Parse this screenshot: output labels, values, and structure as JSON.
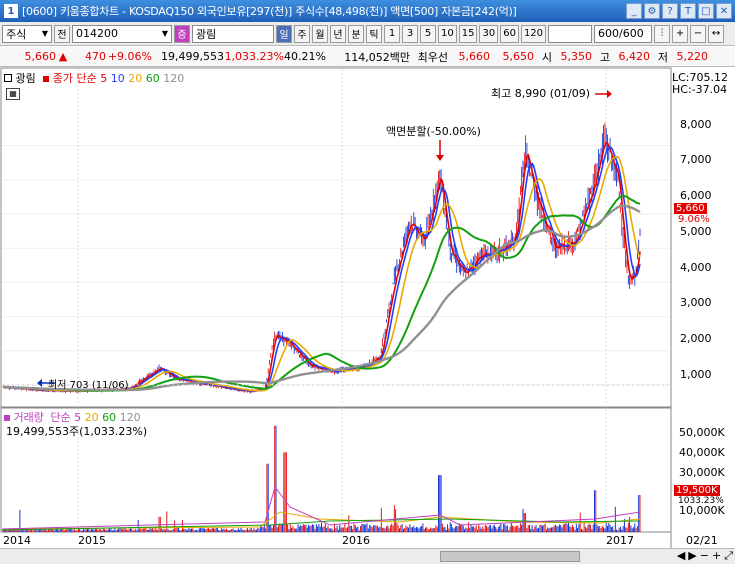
{
  "window": {
    "num": "1",
    "title": "[0600] 키움종합차트 - KOSDAQ150 외국인보유[297(천)] 주식수[48,498(천)] 액면[500] 자본금[242(억)]"
  },
  "toolbar": {
    "market": "주식",
    "mode": "전",
    "code": "014200",
    "search_btn": "증",
    "name": "광림",
    "periods": [
      "일",
      "주",
      "월",
      "년",
      "분",
      "틱"
    ],
    "active_period": "일",
    "intervals": [
      "1",
      "3",
      "5",
      "10",
      "15",
      "30",
      "60",
      "120"
    ],
    "count": "600/600"
  },
  "quote": {
    "price": "5,660",
    "arrow": "▲",
    "change": "470",
    "pct": "+9.06%",
    "volume": "19,499,553",
    "vol_pct": "1,033.23%",
    "turnover": "40.21%",
    "amount": "114,052백만",
    "ask_label": "최우선",
    "ask1": "5,660",
    "ask2": "5,650",
    "open_label": "시",
    "open": "5,350",
    "high_label": "고",
    "high": "6,420",
    "low_label": "저",
    "low": "5,220"
  },
  "price_panel": {
    "name": "광림",
    "ma_label": "종가 단순",
    "ma_periods": [
      "5",
      "10",
      "20",
      "60",
      "120"
    ],
    "lc": "LC:705.12",
    "hc": "HC:-37.04",
    "annotation_high": "최고 8,990 (01/09)",
    "annotation_split": "액면분할(-50.00%)",
    "annotation_low": "최저 703 (11/06)",
    "current_price": "5,660",
    "current_pct": "9.06%",
    "yaxis": [
      "8,000",
      "7,000",
      "6,000",
      "5,000",
      "4,000",
      "3,000",
      "2,000",
      "1,000"
    ]
  },
  "volume_panel": {
    "name": "거래량",
    "ma_label": "단순",
    "ma_periods": [
      "5",
      "20",
      "60",
      "120"
    ],
    "current": "19,499,553주(1,033.23%)",
    "yaxis": [
      "50,000K",
      "40,000K",
      "30,000K",
      "20,000K",
      "10,000K"
    ],
    "current_tag": "19,500K",
    "current_tag2": "1033.23%"
  },
  "xaxis": [
    "2014",
    "2015",
    "2016",
    "2017"
  ],
  "xaxis_right": "02/21",
  "colors": {
    "up": "#e00000",
    "down": "#0020d0",
    "ma5": "#e00000",
    "ma10": "#2040ff",
    "ma20": "#e8a800",
    "ma60": "#10a010",
    "ma120": "#909090",
    "title_bar": "#1e5fb8"
  }
}
